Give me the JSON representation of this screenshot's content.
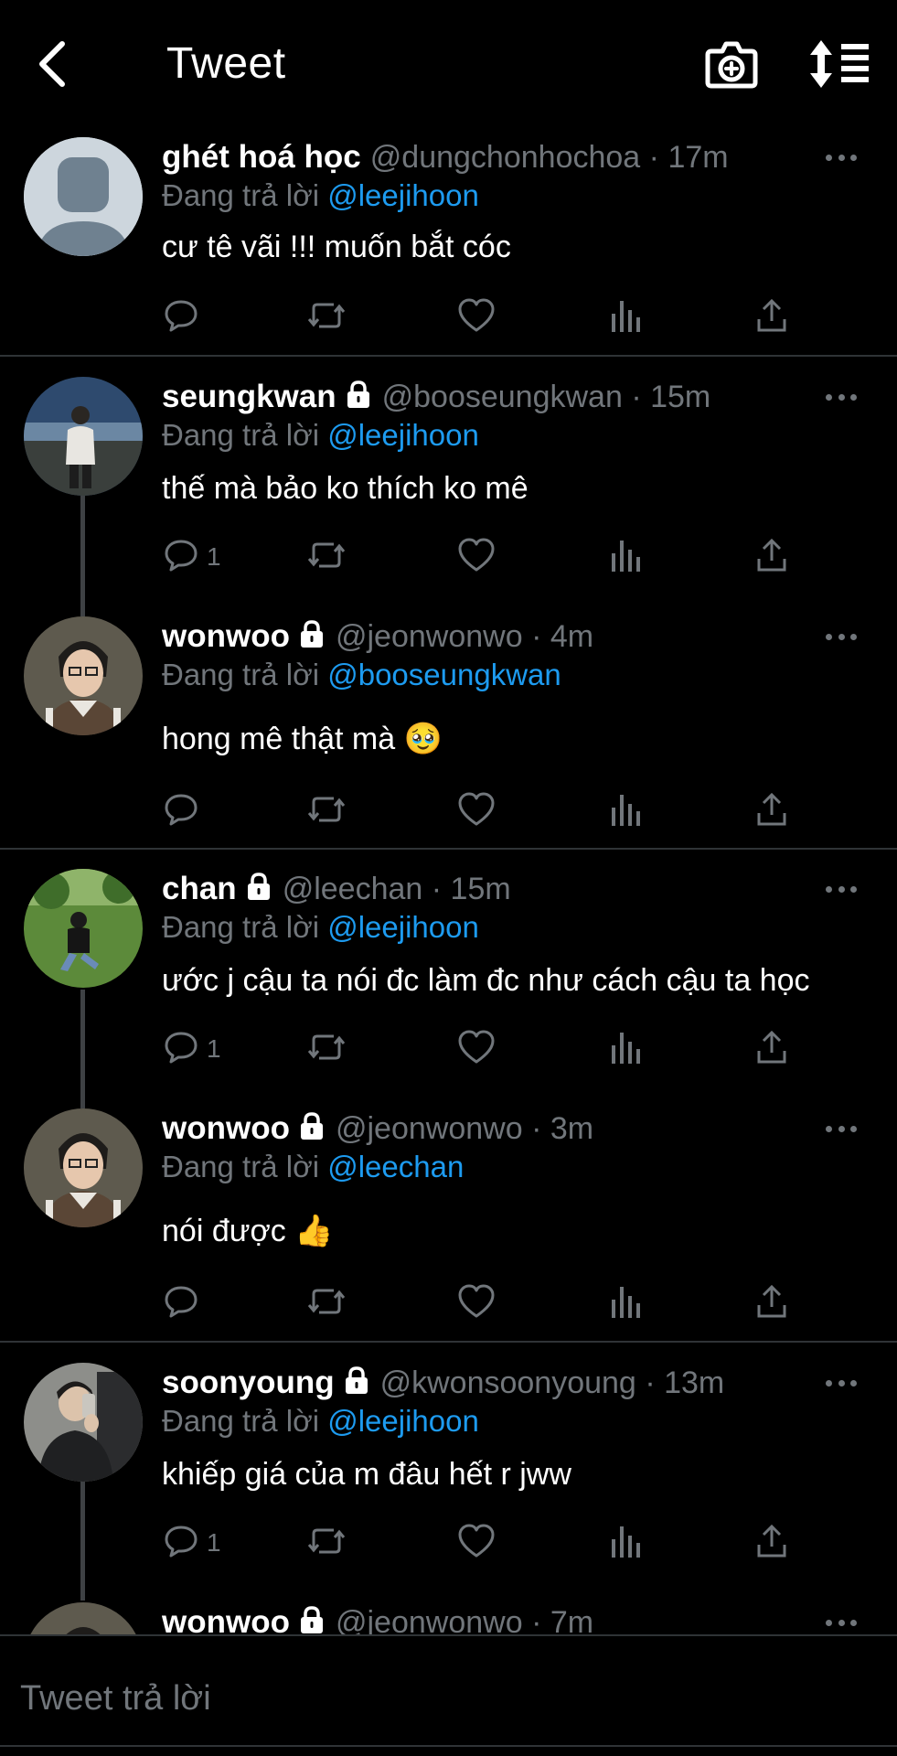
{
  "header": {
    "title": "Tweet",
    "back_icon": "chevron-left-icon",
    "camera_icon": "camera-plus-icon",
    "sort_icon": "sort-lines-icon"
  },
  "colors": {
    "background": "#000000",
    "text": "#ffffff",
    "muted": "#71767b",
    "link": "#1d9bf0",
    "divider": "#2f3336"
  },
  "tweets": [
    {
      "name": "ghét hoá học",
      "locked": false,
      "handle": "@dungchonhochoa",
      "time": "· 17m",
      "replying_label": "Đang trả lời",
      "replying_to": "@leejihoon",
      "text": "cư tê vãi !!! muốn bắt cóc",
      "reply_count": ""
    },
    {
      "name": "seungkwan",
      "locked": true,
      "handle": "@booseungkwan",
      "time": "· 15m",
      "replying_label": "Đang trả lời",
      "replying_to": "@leejihoon",
      "text": "thế mà bảo ko thích ko mê",
      "reply_count": "1"
    },
    {
      "name": "wonwoo",
      "locked": true,
      "handle": "@jeonwonwo",
      "time": "· 4m",
      "replying_label": "Đang trả lời",
      "replying_to": "@booseungkwan",
      "text": "hong mê thật mà 🥹",
      "reply_count": ""
    },
    {
      "name": "chan",
      "locked": true,
      "handle": "@leechan",
      "time": "· 15m",
      "replying_label": "Đang trả lời",
      "replying_to": "@leejihoon",
      "text": "ước j cậu ta nói đc làm đc như cách cậu ta học",
      "reply_count": "1"
    },
    {
      "name": "wonwoo",
      "locked": true,
      "handle": "@jeonwonwo",
      "time": "· 3m",
      "replying_label": "Đang trả lời",
      "replying_to": "@leechan",
      "text": "nói được 👍",
      "reply_count": ""
    },
    {
      "name": "soonyoung",
      "locked": true,
      "handle": "@kwonsoonyoung",
      "time": "· 13m",
      "replying_label": "Đang trả lời",
      "replying_to": "@leejihoon",
      "text": "khiếp giá của m đâu hết r jww",
      "reply_count": "1"
    },
    {
      "name": "wonwoo",
      "locked": true,
      "handle": "@jeonwonwo",
      "time": "· 7m"
    }
  ],
  "reply_bar": {
    "placeholder": "Tweet trả lời"
  }
}
